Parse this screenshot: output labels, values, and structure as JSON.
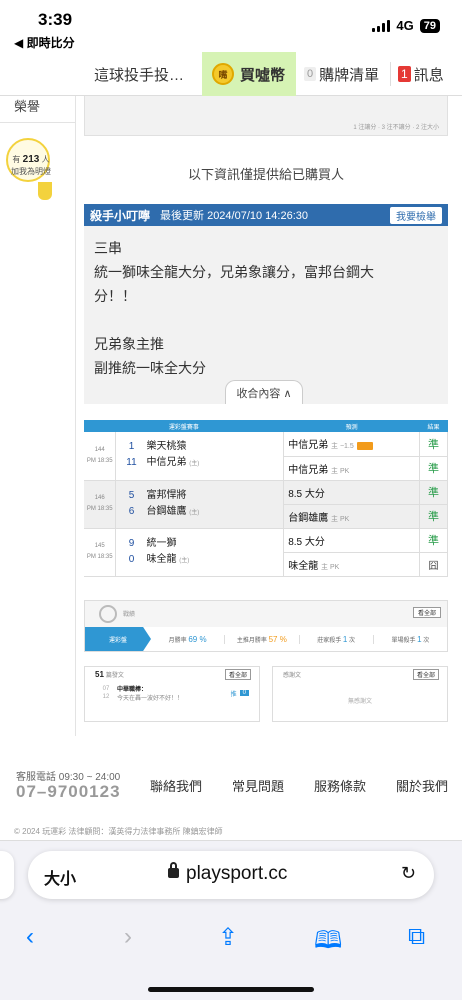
{
  "status": {
    "time": "3:39",
    "back_app": "◀ 即時比分",
    "network": "4G",
    "battery": "79"
  },
  "nav": {
    "title": "這球投手投…",
    "coin_icon_text": "嘴",
    "coins_label": "買噓幣",
    "cart_count": "0",
    "cart_label": "購牌清單",
    "msg_count": "1",
    "msg_label": "訊息"
  },
  "sidebar": {
    "honor": "榮譽",
    "bulb_prefix": "有",
    "bulb_count": "213",
    "bulb_suffix": "人",
    "bulb_line2": "加我為明燈"
  },
  "prev_note": "1 注讓分 · 3 注不讓分 · 2 注大小",
  "buyer_note": "以下資訊僅提供給已購買人",
  "tip": {
    "author": "殺手小叮嚀",
    "updated": "最後更新 2024/07/10 14:26:30",
    "report_label": "我要檢舉",
    "lines": [
      "三串",
      "統一獅味全龍大分，兄弟象讓分，富邦台鋼大",
      "分！！",
      "",
      "兄弟象主推",
      "副推統一味全大分"
    ],
    "collapse_label": "收合內容 ∧"
  },
  "table": {
    "headers": [
      "運彩盤賽事",
      "預測",
      "結果"
    ],
    "games": [
      {
        "no": "144",
        "time": "PM 18:35",
        "away_num": "1",
        "away": "樂天桃猿",
        "home_num": "11",
        "home": "中信兄弟",
        "home_tag": "(主)",
        "picks": [
          {
            "text": "中信兄弟",
            "sub": "主 −1.5",
            "hot": true,
            "result": "準"
          },
          {
            "text": "中信兄弟",
            "sub": "主 PK",
            "hot": false,
            "result": "準"
          }
        ]
      },
      {
        "no": "146",
        "time": "PM 18:35",
        "away_num": "5",
        "away": "富邦悍將",
        "home_num": "6",
        "home": "台鋼雄鷹",
        "home_tag": "(主)",
        "picks": [
          {
            "text": "8.5 大分",
            "sub": "",
            "hot": false,
            "result": "準"
          },
          {
            "text": "台鋼雄鷹",
            "sub": "主 PK",
            "hot": false,
            "result": "準"
          }
        ]
      },
      {
        "no": "145",
        "time": "PM 18:35",
        "away_num": "9",
        "away": "統一獅",
        "home_num": "0",
        "home": "味全龍",
        "home_tag": "(主)",
        "picks": [
          {
            "text": "8.5 大分",
            "sub": "",
            "hot": false,
            "result": "準"
          },
          {
            "text": "味全龍",
            "sub": "主 PK",
            "hot": false,
            "result": "囧"
          }
        ]
      }
    ]
  },
  "record": {
    "title": "戰績",
    "all_label": "看全部",
    "tab": "運彩盤",
    "month_label": "月勝率",
    "month_val": "69 %",
    "home_label": "主推月勝率",
    "home_val": "57 %",
    "league_label": "莊家殺手",
    "league_val": "1",
    "single_label": "單場殺手",
    "single_val": "1",
    "unit": "次"
  },
  "posts": {
    "count": "51",
    "label": "篇發文",
    "all_label": "看全部",
    "date_line1": "07",
    "date_line2": "12",
    "title": "中華職棒：",
    "preview": "今天在轟一波好不好！！",
    "push_label": "推",
    "push_count": "0"
  },
  "thanks": {
    "label": "感謝文",
    "all_label": "看全部",
    "empty": "無感謝文"
  },
  "footer": {
    "phone_label": "客服電話 09:30 ~ 24:00",
    "phone": "07–9700123",
    "links": [
      "聯絡我們",
      "常見問題",
      "服務條款",
      "關於我們"
    ],
    "copyright": "© 2024 玩運彩 法律顧問：漢英得力法律事務所 陳鎮宏律師"
  },
  "browser": {
    "aa": "大小",
    "url": "playsport.cc"
  },
  "colors": {
    "accent_blue": "#2f6cad",
    "table_blue": "#2f97d3",
    "win_green": "#2a9d4b",
    "coin_bg": "#d6f3b4"
  }
}
